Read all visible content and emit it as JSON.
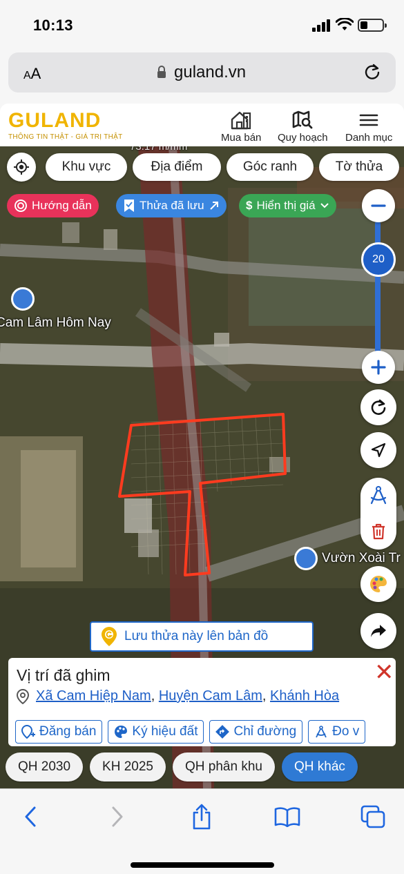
{
  "status": {
    "time": "10:13"
  },
  "browser": {
    "text_size": "AA",
    "url": "guland.vn"
  },
  "app": {
    "logo": "GULAND",
    "tagline": "THÔNG TIN THẬT - GIÁ TRỊ THẬT",
    "nav": [
      {
        "label": "Mua bán",
        "icon": "house-icon"
      },
      {
        "label": "Quy hoạch",
        "icon": "map-search-icon"
      },
      {
        "label": "Danh mục",
        "icon": "menu-icon"
      }
    ]
  },
  "map": {
    "filters": [
      "Khu vực",
      "Địa điểm",
      "Góc ranh",
      "Tờ thửa"
    ],
    "tags": {
      "guide": "Hướng dẫn",
      "saved": "Thửa đã lưu",
      "price": "Hiển thị giá"
    },
    "zoom_level": "20",
    "place_labels": [
      "Cam Lâm Hôm Nay",
      "Vườn Xoài Tr"
    ],
    "partial_top_label": "73.17 m/mm",
    "save_banner": "Lưu thửa này lên bản đồ",
    "colors": {
      "parcel_outline": "#ff3b1f",
      "accent": "#1e66c8",
      "guide_tag": "#e8325a",
      "saved_tag": "#3a86e0",
      "price_tag": "#3aa655"
    }
  },
  "sheet": {
    "title": "Vị trí đã ghim",
    "address": {
      "commune": "Xã Cam Hiệp Nam",
      "district": "Huyện Cam Lâm",
      "province": "Khánh Hòa",
      "sep": ","
    },
    "actions": [
      "Đăng bán",
      "Ký hiệu đất",
      "Chỉ đường",
      "Đo v"
    ]
  },
  "plans": [
    "QH 2030",
    "KH 2025",
    "QH phân khu",
    "QH khác"
  ]
}
